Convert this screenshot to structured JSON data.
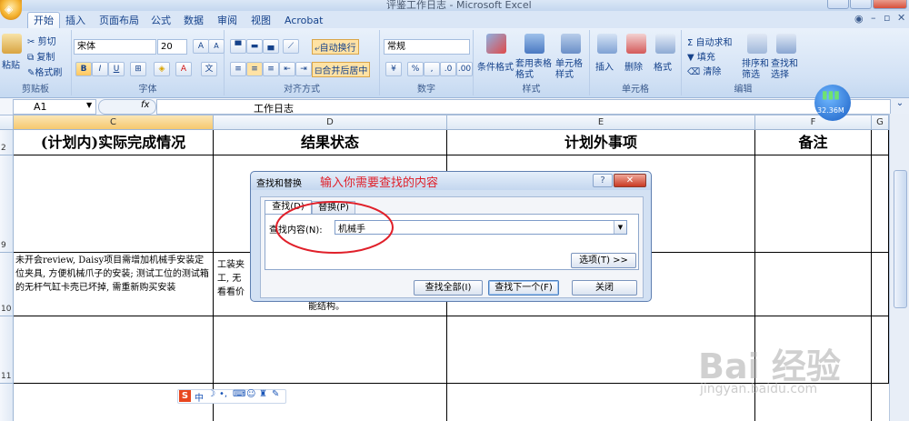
{
  "window": {
    "title": "评鉴工作日志 - Microsoft Excel"
  },
  "tabs": [
    "开始",
    "插入",
    "页面布局",
    "公式",
    "数据",
    "审阅",
    "视图",
    "Acrobat"
  ],
  "clipboard": {
    "paste": "粘贴",
    "cut": "剪切",
    "copy": "复制",
    "format_painter": "格式刷",
    "label": "剪贴板"
  },
  "font": {
    "name": "宋体",
    "size": "20",
    "label": "字体",
    "bold": "B",
    "italic": "I",
    "underline": "U",
    "grow": "A",
    "shrink": "A"
  },
  "alignment": {
    "wrap": "自动换行",
    "merge": "合并后居中",
    "label": "对齐方式"
  },
  "number": {
    "format": "常规",
    "percent": "%",
    "comma": ",",
    "label": "数字"
  },
  "styles": {
    "conditional": "条件格式",
    "table": "套用表格格式",
    "cell": "单元格样式",
    "label": "样式"
  },
  "cells": {
    "insert": "插入",
    "delete": "删除",
    "format": "格式",
    "label": "单元格"
  },
  "editing": {
    "autosum": "Σ 自动求和",
    "fill": "填充",
    "clear": "清除",
    "sort": "排序和筛选",
    "find": "查找和选择",
    "label": "编辑"
  },
  "network_badge": "32.36M",
  "formula_bar": {
    "cell_ref": "A1",
    "fx": "fx",
    "content": "工作日志"
  },
  "columns": [
    "C",
    "D",
    "E",
    "F",
    "G"
  ],
  "rows": [
    "2",
    "9",
    "10",
    "11"
  ],
  "headers": {
    "c": "(计划内)实际完成情况",
    "d": "结果状态",
    "e": "计划外事项",
    "f": "备注"
  },
  "cell_c10": "未开会review, Daisy项目需增加机械手安装定位夹具, 方便机械爪子的安装; 测试工位的测试箱的无杆气缸卡壳已坏掉, 需重新购买安装",
  "cell_d10_fragments": [
    "工装夹",
    "工, 无",
    "看看价",
    "能结构。"
  ],
  "dialog": {
    "title": "查找和替换",
    "annotation": "输入你需要查找的内容",
    "tab_find": "查找(D)",
    "tab_replace": "替换(P)",
    "find_label": "查找内容(N):",
    "find_value": "机械手",
    "options": "选项(T) >>",
    "find_all": "查找全部(I)",
    "find_next": "查找下一个(F)",
    "close": "关闭",
    "help": "?",
    "x": "✕"
  },
  "ime_toolbar": {
    "logo": "S",
    "lang": "中"
  },
  "watermark": {
    "brand": "Bai 经验",
    "url": "jingyan.baidu.com"
  },
  "colors": {
    "ribbon": "#dbe7f6",
    "dialog_frame": "#d3e1f3",
    "annotation": "#e0202a",
    "office_orb": "#f5b330"
  }
}
